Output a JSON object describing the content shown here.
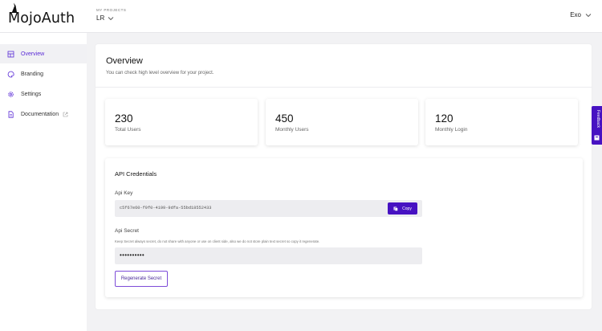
{
  "header": {
    "logo_text": "MojoAuth",
    "project_caption": "MY PROJECTS",
    "project_name": "LR",
    "user_name": "Exo"
  },
  "sidebar": {
    "items": [
      {
        "label": "Overview",
        "icon": "overview-icon",
        "active": true
      },
      {
        "label": "Branding",
        "icon": "palette-icon",
        "active": false
      },
      {
        "label": "Settings",
        "icon": "gear-icon",
        "active": false
      },
      {
        "label": "Documentation",
        "icon": "document-icon",
        "active": false,
        "external": true
      }
    ]
  },
  "main": {
    "title": "Overview",
    "subtitle": "You can check high level overview for your project.",
    "stats": [
      {
        "value": "230",
        "label": "Total Users"
      },
      {
        "value": "450",
        "label": "Monthly Users"
      },
      {
        "value": "120",
        "label": "Monthly Login"
      }
    ],
    "credentials": {
      "title": "API Credentials",
      "api_key_label": "Api Key",
      "api_key_value": "c5f67e60-f9f0-4199-9dfa-55bd18552433",
      "copy_label": "Copy",
      "api_secret_label": "Api Secret",
      "api_secret_help": "Keep Secret always secret, do not share with anyone or use on client side, also we do not store plain text secret so copy it regenerate.",
      "api_secret_value": "••••••••••",
      "regenerate_label": "Regenerate Secret"
    }
  },
  "feedback": {
    "label": "Feedback"
  },
  "colors": {
    "accent": "#4712c2",
    "active_nav_text": "#5a2bd6",
    "page_bg": "#f2f2f4"
  }
}
